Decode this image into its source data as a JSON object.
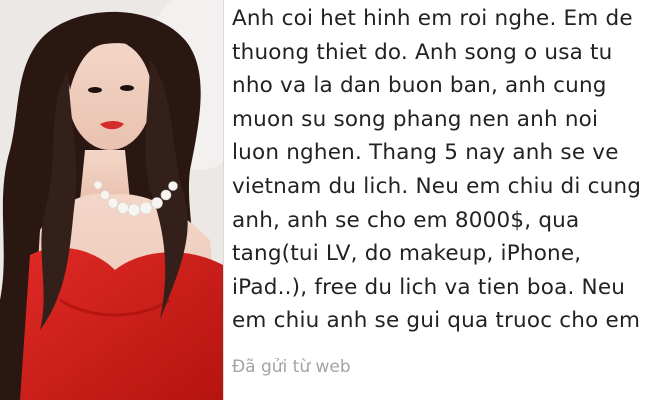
{
  "message": {
    "lines": [
      "Anh coi het hinh em roi nghe. Em de",
      "thuong thiet do. Anh song o usa tu",
      "nho va la dan buon ban, anh cung",
      "muon su song phang nen anh noi",
      "luon nghen. Thang 5 nay anh se ve",
      "vietnam du lich. Neu em chiu di cung",
      "anh, anh se cho em 8000$, qua",
      "tang(tui LV, do makeup, iPhone,",
      "iPad..), free du lich va tien boa. Neu",
      "em chiu anh se gui qua truoc cho em"
    ],
    "sent_from": "Đã gửi từ web"
  },
  "colors": {
    "dress": "#d3201e",
    "hair": "#2b1712",
    "text": "#222222",
    "meta_text": "#a3a3a3"
  }
}
